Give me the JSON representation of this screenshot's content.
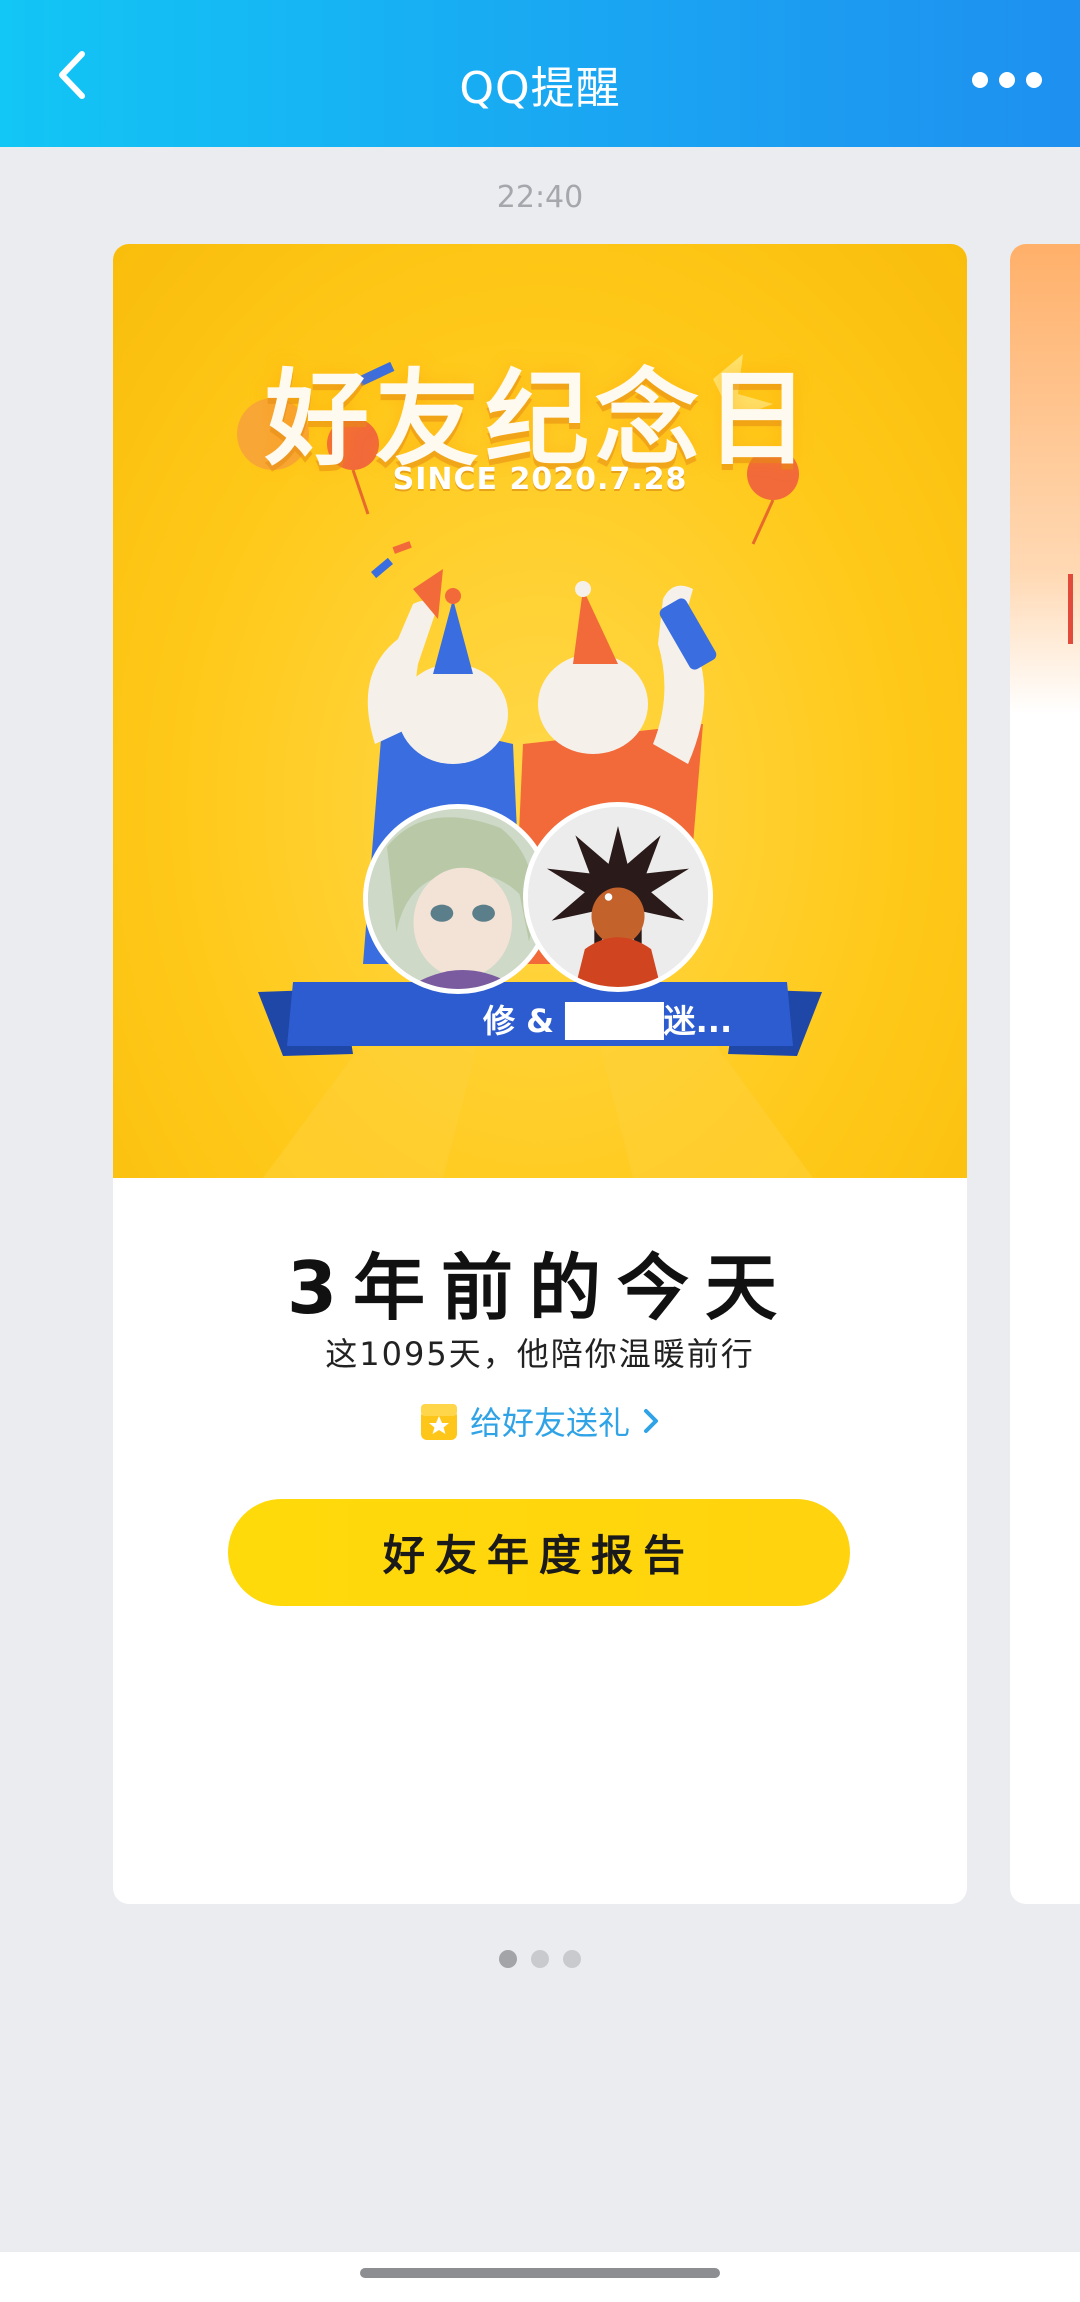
{
  "header": {
    "title": "QQ提醒",
    "back_icon": "chevron-left-icon",
    "more_icon": "ellipsis-icon"
  },
  "timestamp": "22:40",
  "card": {
    "banner": {
      "title": "好友纪念日",
      "since": "SINCE 2020.7.28",
      "names": "修 & ████迷..."
    },
    "headline": "3年前的今天",
    "subline": "这1095天，他陪你温暖前行",
    "gift_link": "给好友送礼",
    "report_button": "好友年度报告"
  },
  "pager": {
    "count": 3,
    "active": 0
  },
  "colors": {
    "header_start": "#12c6f5",
    "header_end": "#1e90f0",
    "banner_yellow": "#ffc919",
    "button_yellow": "#ffd30e",
    "link_blue": "#2fa3e6",
    "ribbon_blue": "#2c5ccf"
  }
}
